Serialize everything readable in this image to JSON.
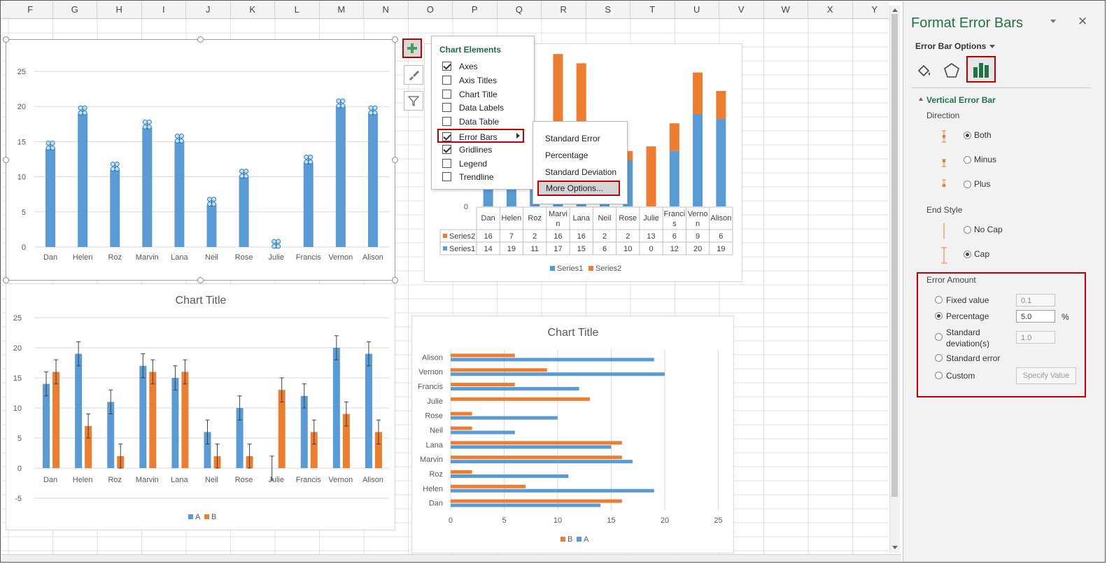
{
  "columns": [
    "F",
    "G",
    "H",
    "I",
    "J",
    "K",
    "L",
    "M",
    "N",
    "O",
    "P",
    "Q",
    "R",
    "S",
    "T",
    "U",
    "V",
    "W",
    "X",
    "Y"
  ],
  "colors": {
    "blue": "#5b9bd5",
    "orange": "#ed7d31",
    "accent_green": "#217346",
    "highlight_red": "#c00000"
  },
  "chart_data": [
    {
      "type": "bar",
      "categories": [
        "Dan",
        "Helen",
        "Roz",
        "Marvin",
        "Lana",
        "Neil",
        "Rose",
        "Julie",
        "Francis",
        "Vernon",
        "Alison"
      ],
      "values": [
        14,
        19,
        11,
        17,
        15,
        6,
        10,
        0,
        12,
        20,
        19
      ],
      "yticks": [
        "0",
        "5",
        "10",
        "15",
        "20",
        "25"
      ],
      "ylim": [
        0,
        27
      ]
    },
    {
      "type": "bar",
      "stacked": true,
      "categories": [
        "Dan",
        "Helen",
        "Roz",
        "Marvi\nn",
        "Lana",
        "Neil",
        "Rose",
        "Julie",
        "Franci\ns",
        "Verno\nn",
        "Alison"
      ],
      "series": [
        {
          "name": "Series2",
          "values": [
            16,
            7,
            2,
            16,
            16,
            2,
            2,
            13,
            6,
            9,
            6
          ]
        },
        {
          "name": "Series1",
          "values": [
            14,
            19,
            11,
            17,
            15,
            6,
            10,
            0,
            12,
            20,
            19
          ]
        }
      ],
      "yticks": [
        "0"
      ],
      "legend": [
        "Series1",
        "Series2"
      ]
    },
    {
      "type": "bar",
      "title": "Chart Title",
      "categories": [
        "Dan",
        "Helen",
        "Roz",
        "Marvin",
        "Lana",
        "Neil",
        "Rose",
        "Julie",
        "Francis",
        "Vernon",
        "Alison"
      ],
      "series": [
        {
          "name": "A",
          "values": [
            14,
            19,
            11,
            17,
            15,
            6,
            10,
            0,
            12,
            20,
            19
          ]
        },
        {
          "name": "B",
          "values": [
            16,
            7,
            2,
            16,
            16,
            2,
            2,
            13,
            6,
            9,
            6
          ]
        }
      ],
      "yticks": [
        "-5",
        "0",
        "5",
        "10",
        "15",
        "20",
        "25"
      ],
      "ylim": [
        -5,
        25
      ],
      "legend": [
        "A",
        "B"
      ]
    },
    {
      "type": "bar",
      "orientation": "horizontal",
      "title": "Chart Title",
      "categories": [
        "Dan",
        "Helen",
        "Roz",
        "Marvin",
        "Lana",
        "Neil",
        "Rose",
        "Julie",
        "Francis",
        "Vernon",
        "Alison"
      ],
      "series": [
        {
          "name": "A",
          "values": [
            14,
            19,
            11,
            17,
            15,
            6,
            10,
            0,
            12,
            20,
            19
          ]
        },
        {
          "name": "B",
          "values": [
            16,
            7,
            2,
            16,
            16,
            2,
            2,
            13,
            6,
            9,
            6
          ]
        }
      ],
      "xticks": [
        "0",
        "5",
        "10",
        "15",
        "20",
        "25"
      ],
      "xlim": [
        0,
        25
      ],
      "legend": [
        "B",
        "A"
      ]
    }
  ],
  "chart_elements": {
    "title": "Chart Elements",
    "items": [
      {
        "label": "Axes",
        "checked": true
      },
      {
        "label": "Axis Titles",
        "checked": false
      },
      {
        "label": "Chart Title",
        "checked": false
      },
      {
        "label": "Data Labels",
        "checked": false
      },
      {
        "label": "Data Table",
        "checked": false
      },
      {
        "label": "Error Bars",
        "checked": true
      },
      {
        "label": "Gridlines",
        "checked": true
      },
      {
        "label": "Legend",
        "checked": false
      },
      {
        "label": "Trendline",
        "checked": false
      }
    ],
    "submenu": [
      "Standard Error",
      "Percentage",
      "Standard Deviation",
      "More Options..."
    ]
  },
  "pane": {
    "title": "Format Error Bars",
    "options_label": "Error Bar Options",
    "section": "Vertical Error Bar",
    "direction_label": "Direction",
    "direction": [
      {
        "label": "Both",
        "selected": true
      },
      {
        "label": "Minus",
        "selected": false
      },
      {
        "label": "Plus",
        "selected": false
      }
    ],
    "end_style_label": "End Style",
    "end_style": [
      {
        "label": "No Cap",
        "selected": false
      },
      {
        "label": "Cap",
        "selected": true
      }
    ],
    "error_amount_label": "Error Amount",
    "fixed_value": {
      "label": "Fixed value",
      "value": "0.1"
    },
    "percentage": {
      "label": "Percentage",
      "value": "5.0",
      "unit": "%"
    },
    "std_dev": {
      "label1": "Standard",
      "label2": "deviation(s)",
      "value": "1.0"
    },
    "std_error": {
      "label": "Standard error"
    },
    "custom": {
      "label": "Custom",
      "button": "Specify Value"
    }
  }
}
